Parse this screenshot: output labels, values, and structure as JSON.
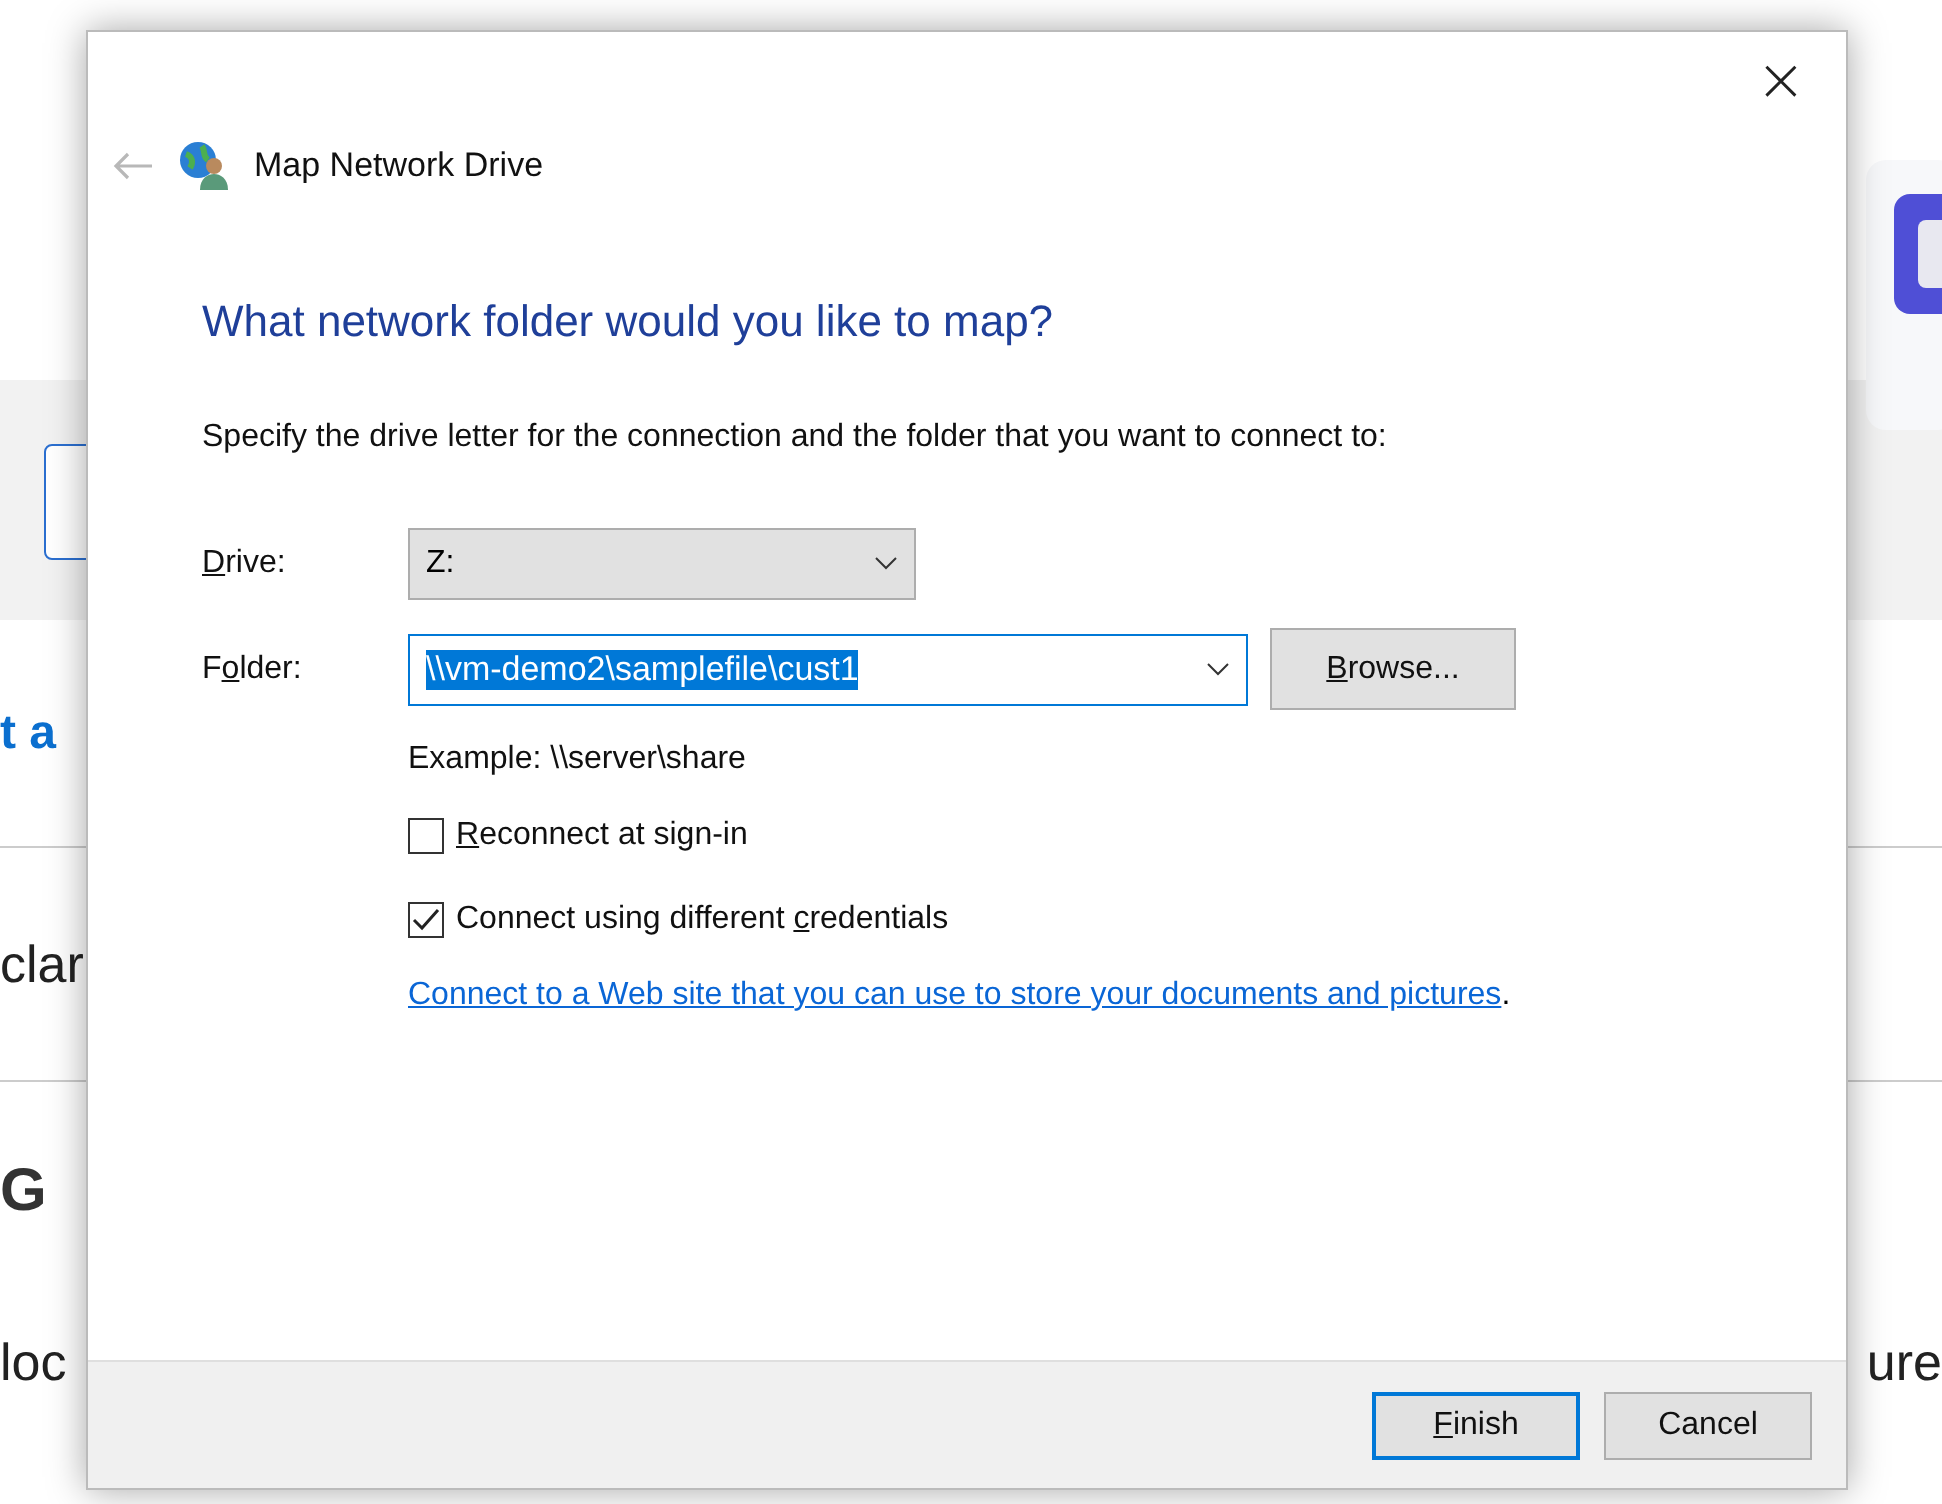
{
  "background_page": {
    "link_text": "t a",
    "text_1": "clar",
    "heading": "G",
    "text_2": "loc",
    "text_3": "ure"
  },
  "dialog": {
    "title": "Map Network Drive",
    "close": "×",
    "back_disabled": true,
    "heading": "What network folder would you like to map?",
    "instruction": "Specify the drive letter for the connection and the folder that you want to connect to:",
    "drive": {
      "label": {
        "key": "D",
        "after": "rive:"
      },
      "value": "Z:"
    },
    "folder": {
      "label": {
        "before": "F",
        "key": "o",
        "after": "lder:"
      },
      "value": "\\\\vm-demo2\\samplefile\\cust1",
      "text_selected": true
    },
    "browse_button": {
      "key": "B",
      "after": "rowse..."
    },
    "example": "Example: \\\\server\\share",
    "options": [
      {
        "label": {
          "key": "R",
          "after": "econnect at sign-in"
        },
        "checked": false
      },
      {
        "label": {
          "before": "Connect using different ",
          "key": "c",
          "after": "redentials"
        },
        "checked": true
      }
    ],
    "link": "Connect to a Web site that you can use to store your documents and pictures",
    "link_suffix": ".",
    "buttons": [
      {
        "label": {
          "key": "F",
          "after": "inish"
        },
        "default": true
      },
      {
        "label": {
          "before": "Cancel"
        },
        "default": false
      }
    ]
  }
}
